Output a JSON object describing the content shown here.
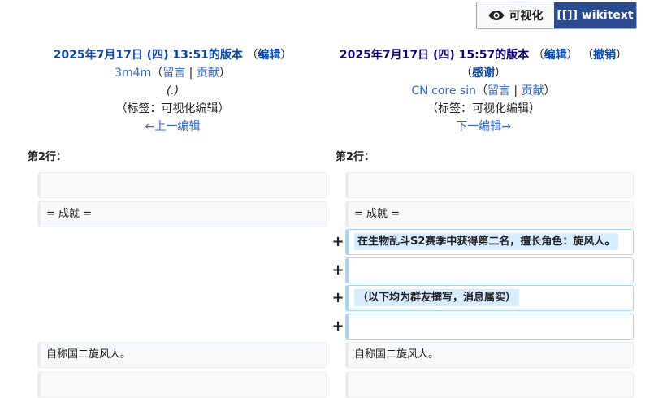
{
  "toggle": {
    "visual_label": "可视化",
    "wikitext_label": "[[]] wikitext"
  },
  "left_header": {
    "revision": "2025年7月17日 (四) 13:51的版本",
    "edit": "编辑",
    "user": "3m4m",
    "talk": "留言",
    "contribs": "贡献",
    "summary": "(.)",
    "tags": "（标签：可视化编辑）",
    "prev": "←上一编辑"
  },
  "right_header": {
    "revision": "2025年7月17日 (四) 15:57的版本",
    "edit": "编辑",
    "undo": "撤销",
    "thank": "感谢",
    "user": "CN core sin",
    "talk": "留言",
    "contribs": "贡献",
    "tags": "（标签：可视化编辑）",
    "next": "下一编辑→"
  },
  "diff": {
    "line_label_left": "第2行：",
    "line_label_right": "第2行：",
    "context_rows": [
      "",
      "= 成就 =",
      "自称国二旋风人。",
      ""
    ],
    "added_rows": [
      "在生物乱斗S2赛季中获得第二名，擅长角色：旋风人。",
      "",
      "（以下均为群友撰写，消息属实）",
      ""
    ],
    "plus_marker": "+"
  }
}
